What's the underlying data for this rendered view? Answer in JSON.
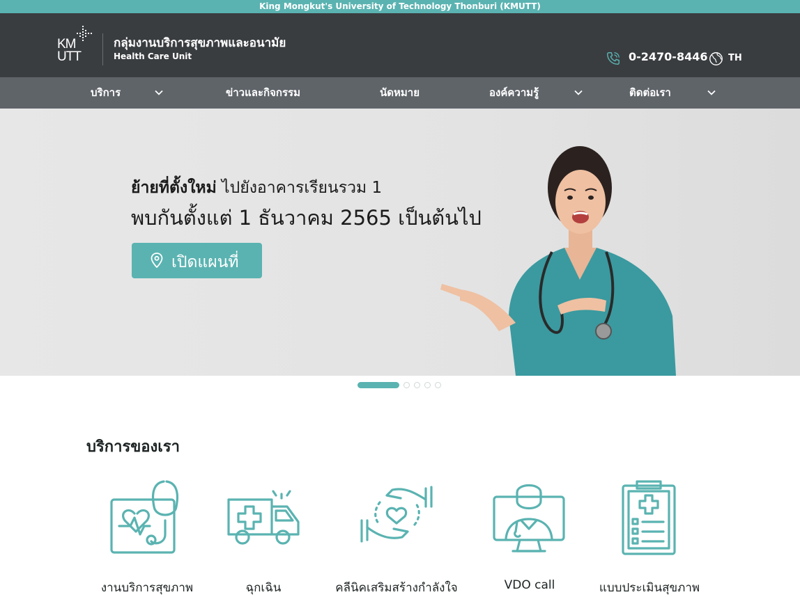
{
  "topbar": {
    "university": "King Mongkut's University of Technology Thonburi (KMUTT)"
  },
  "header": {
    "logo_text": "KMUTT",
    "org_name_th": "กลุ่มงานบริการสุขภาพและอนามัย",
    "org_name_en": "Health Care Unit",
    "phone": "0-2470-8446",
    "language": "TH",
    "icons": [
      "phone-icon",
      "globe-icon"
    ]
  },
  "nav": {
    "items": [
      {
        "label": "บริการ",
        "has_dropdown": true
      },
      {
        "label": "ข่าวและกิจกรรม",
        "has_dropdown": false
      },
      {
        "label": "นัดหมาย",
        "has_dropdown": false
      },
      {
        "label": "องค์ความรู้",
        "has_dropdown": true
      },
      {
        "label": "ติดต่อเรา",
        "has_dropdown": true
      }
    ]
  },
  "hero": {
    "line1_bold": "ย้ายที่ตั้งใหม่",
    "line1_rest": " ไปยังอาคารเรียนรวม 1",
    "line2": "พบกันตั้งแต่ 1 ธันวาคม 2565 เป็นต้นไป",
    "button_label": "เปิดแผนที่",
    "slide_count": 5,
    "active_slide": 1
  },
  "services": {
    "title": "บริการของเรา",
    "items": [
      {
        "label": "งานบริการสุขภาพ",
        "icon": "health-record-stethoscope-icon"
      },
      {
        "label": "ฉุกเฉิน",
        "icon": "ambulance-icon"
      },
      {
        "label": "คลีนิคเสริมสร้างกำลังใจ",
        "icon": "caring-hands-heart-icon"
      },
      {
        "label": "VDO call",
        "icon": "video-call-doctor-icon"
      },
      {
        "label": "แบบประเมินสุขภาพ",
        "icon": "clipboard-checklist-icon"
      }
    ]
  },
  "colors": {
    "accent": "#5ab3b1",
    "header_bg": "#3a3d40",
    "nav_bg": "#5f6469"
  }
}
